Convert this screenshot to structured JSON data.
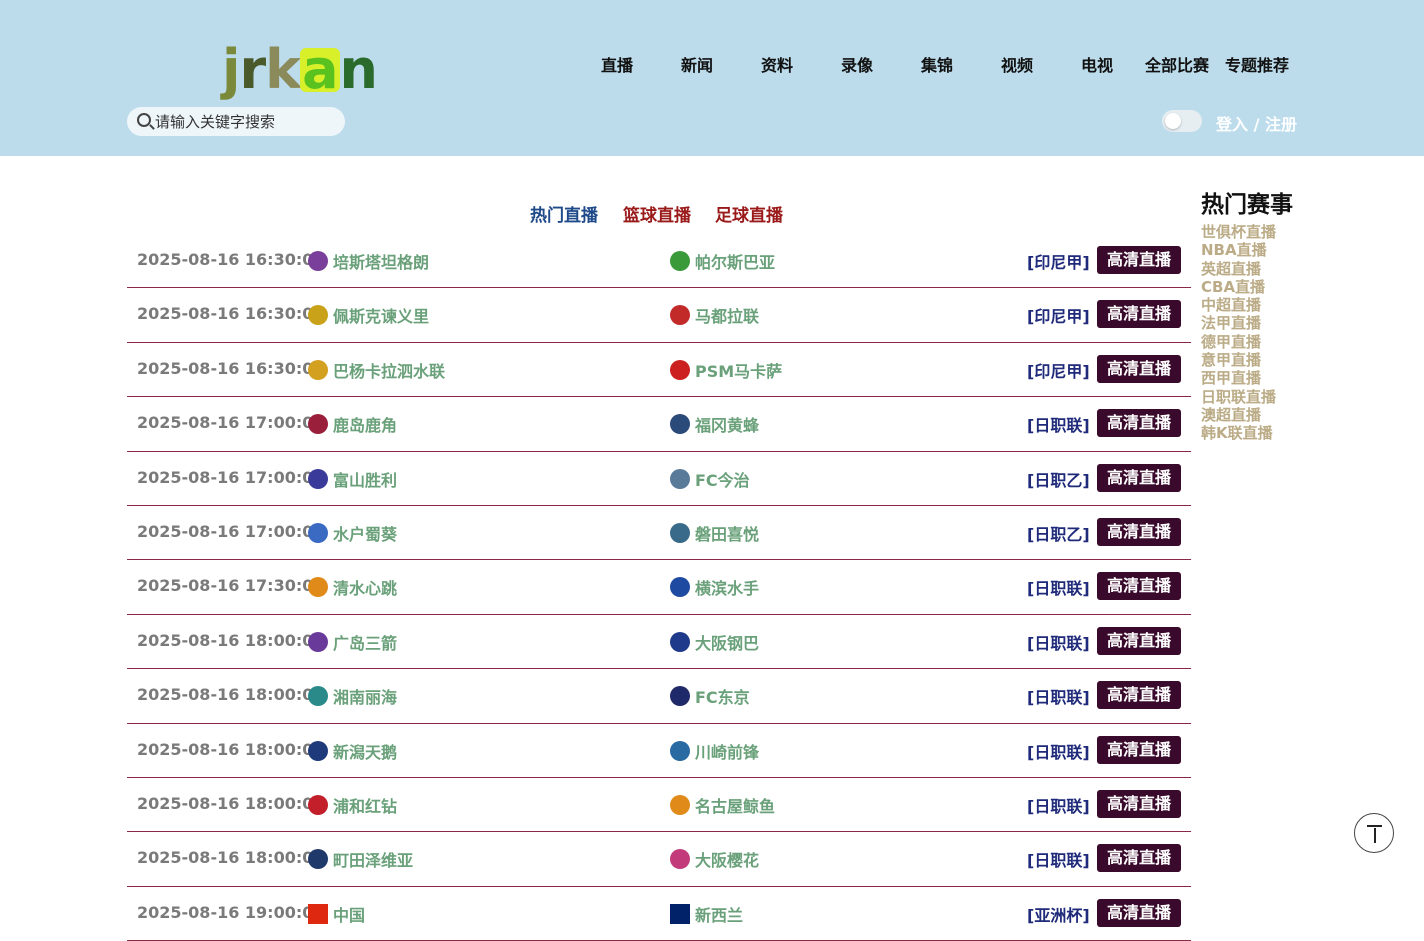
{
  "header": {
    "logo_letters": [
      "j",
      "r",
      "k",
      "a",
      "n"
    ],
    "nav": [
      "直播",
      "新闻",
      "资料",
      "录像",
      "集锦",
      "视频",
      "电视",
      "全部比赛",
      "专题推荐"
    ],
    "search_placeholder": "请输入关键字搜索",
    "login_label": "登入 / 注册"
  },
  "tabs": [
    {
      "label": "热门直播",
      "color": "#1f4a8a"
    },
    {
      "label": "篮球直播",
      "color": "#9a1a1a"
    },
    {
      "label": "足球直播",
      "color": "#9a1a1a"
    }
  ],
  "matches": [
    {
      "time": "2025-08-16 16:30:00",
      "home": "培斯塔坦格朗",
      "away": "帕尔斯巴亚",
      "league": "[印尼甲]",
      "button": "高清直播",
      "home_color": "#7a3f9a",
      "away_color": "#3a9a3a"
    },
    {
      "time": "2025-08-16 16:30:00",
      "home": "佩斯克谏义里",
      "away": "马都拉联",
      "league": "[印尼甲]",
      "button": "高清直播",
      "home_color": "#c9a21a",
      "away_color": "#c22a2a"
    },
    {
      "time": "2025-08-16 16:30:00",
      "home": "巴杨卡拉泗水联",
      "away": "PSM马卡萨",
      "league": "[印尼甲]",
      "button": "高清直播",
      "home_color": "#d4a020",
      "away_color": "#cc1f1f"
    },
    {
      "time": "2025-08-16 17:00:00",
      "home": "鹿岛鹿角",
      "away": "福冈黄蜂",
      "league": "[日职联]",
      "button": "高清直播",
      "home_color": "#9a1f3a",
      "away_color": "#2a4a7a"
    },
    {
      "time": "2025-08-16 17:00:00",
      "home": "富山胜利",
      "away": "FC今治",
      "league": "[日职乙]",
      "button": "高清直播",
      "home_color": "#3a3a9a",
      "away_color": "#5a7a9a"
    },
    {
      "time": "2025-08-16 17:00:00",
      "home": "水户蜀葵",
      "away": "磐田喜悦",
      "league": "[日职乙]",
      "button": "高清直播",
      "home_color": "#3a6ac2",
      "away_color": "#3a6a8a"
    },
    {
      "time": "2025-08-16 17:30:00",
      "home": "清水心跳",
      "away": "横滨水手",
      "league": "[日职联]",
      "button": "高清直播",
      "home_color": "#e08a1a",
      "away_color": "#1f4aa2"
    },
    {
      "time": "2025-08-16 18:00:00",
      "home": "广岛三箭",
      "away": "大阪钢巴",
      "league": "[日职联]",
      "button": "高清直播",
      "home_color": "#6a3a9a",
      "away_color": "#1f3a8a"
    },
    {
      "time": "2025-08-16 18:00:00",
      "home": "湘南丽海",
      "away": "FC东京",
      "league": "[日职联]",
      "button": "高清直播",
      "home_color": "#2a8a8a",
      "away_color": "#1f2a6a"
    },
    {
      "time": "2025-08-16 18:00:00",
      "home": "新潟天鹅",
      "away": "川崎前锋",
      "league": "[日职联]",
      "button": "高清直播",
      "home_color": "#1f3a7a",
      "away_color": "#2a6aa2"
    },
    {
      "time": "2025-08-16 18:00:00",
      "home": "浦和红钻",
      "away": "名古屋鲸鱼",
      "league": "[日职联]",
      "button": "高清直播",
      "home_color": "#c21f2a",
      "away_color": "#e08a1a"
    },
    {
      "time": "2025-08-16 18:00:00",
      "home": "町田泽维亚",
      "away": "大阪樱花",
      "league": "[日职联]",
      "button": "高清直播",
      "home_color": "#1f3a6a",
      "away_color": "#c23a7a"
    },
    {
      "time": "2025-08-16 19:00:00",
      "home": "中国",
      "away": "新西兰",
      "league": "[亚洲杯]",
      "button": "高清直播",
      "home_color": "#de2910",
      "away_color": "#012169"
    }
  ],
  "sidebar": {
    "title": "热门赛事",
    "items": [
      "世俱杯直播",
      "NBA直播",
      "英超直播",
      "CBA直播",
      "中超直播",
      "法甲直播",
      "德甲直播",
      "意甲直播",
      "西甲直播",
      "日职联直播",
      "澳超直播",
      "韩K联直播"
    ]
  }
}
